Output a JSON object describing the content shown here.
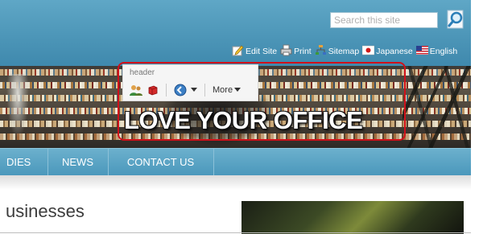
{
  "search": {
    "placeholder": "Search this site"
  },
  "toolbar_links": [
    {
      "label": "Edit Site",
      "icon": "edit-site-icon"
    },
    {
      "label": "Print",
      "icon": "print-icon"
    },
    {
      "label": "Sitemap",
      "icon": "sitemap-icon"
    },
    {
      "label": "Japanese",
      "icon": "japan-flag-icon"
    },
    {
      "label": "English",
      "icon": "us-flag-icon"
    }
  ],
  "header_panel": {
    "title": "header",
    "more_label": "More"
  },
  "hero": {
    "tagline": "LOVE YOUR OFFICE"
  },
  "nav": [
    {
      "label": "DIES"
    },
    {
      "label": "NEWS"
    },
    {
      "label": "CONTACT US"
    }
  ],
  "content": {
    "heading": "usinesses"
  },
  "colors": {
    "topbar": "#4d96b8",
    "nav": "#5aa3c4",
    "highlight": "#d0101a"
  }
}
